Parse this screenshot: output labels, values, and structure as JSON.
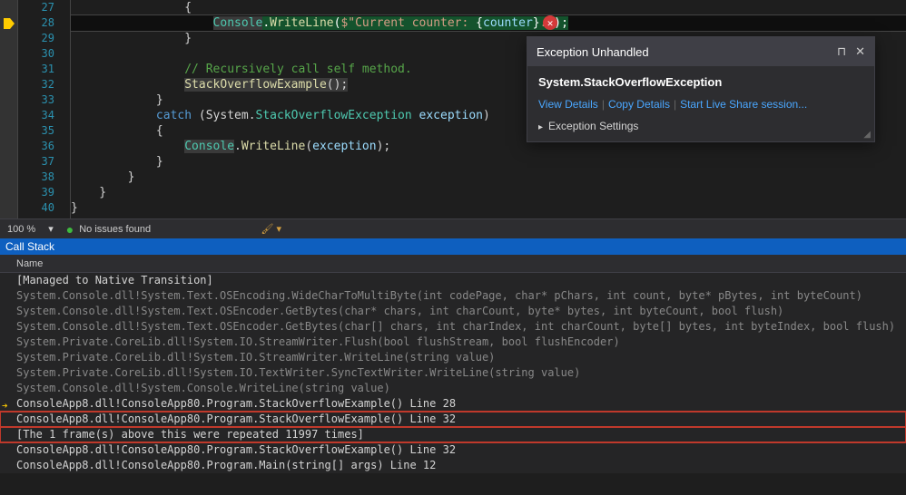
{
  "editor": {
    "lines": [
      27,
      28,
      29,
      30,
      31,
      32,
      33,
      34,
      35,
      36,
      37,
      38,
      39,
      40
    ],
    "comment": "// Recursively call self method.",
    "call_stmt": "StackOverflowExample",
    "catch_kw": "catch",
    "system_ns": "System",
    "exc_type_name": "StackOverflowException",
    "exc_var": "exception",
    "console_type": "Console",
    "writeline_method": "WriteLine",
    "interp_str_open": "$\"Current counter: ",
    "interp_var": "counter",
    "interp_str_close": ".\"",
    "stmt_end": ");",
    "brace_open": "{",
    "brace_close": "}",
    "dot": ".",
    "paren_open": "(",
    "paren_close": ")",
    "semi": ";",
    "space": " "
  },
  "popup": {
    "title": "Exception Unhandled",
    "exc_type": "System.StackOverflowException",
    "view_details": "View Details",
    "copy_details": "Copy Details",
    "live_share": "Start Live Share session...",
    "settings": "Exception Settings",
    "pin_icon": "⊓",
    "close_icon": "✕"
  },
  "status": {
    "zoom": "100 %",
    "issues": "No issues found"
  },
  "callstack": {
    "title": "Call Stack",
    "column": "Name",
    "rows": [
      {
        "text": "[Managed to Native Transition]",
        "bright": true
      },
      {
        "text": "System.Console.dll!System.Text.OSEncoding.WideCharToMultiByte(int codePage, char* pChars, int count, byte* pBytes, int byteCount)"
      },
      {
        "text": "System.Console.dll!System.Text.OSEncoder.GetBytes(char* chars, int charCount, byte* bytes, int byteCount, bool flush)"
      },
      {
        "text": "System.Console.dll!System.Text.OSEncoder.GetBytes(char[] chars, int charIndex, int charCount, byte[] bytes, int byteIndex, bool flush)"
      },
      {
        "text": "System.Private.CoreLib.dll!System.IO.StreamWriter.Flush(bool flushStream, bool flushEncoder)"
      },
      {
        "text": "System.Private.CoreLib.dll!System.IO.StreamWriter.WriteLine(string value)"
      },
      {
        "text": "System.Private.CoreLib.dll!System.IO.TextWriter.SyncTextWriter.WriteLine(string value)"
      },
      {
        "text": "System.Console.dll!System.Console.WriteLine(string value)"
      },
      {
        "text": "ConsoleApp8.dll!ConsoleApp80.Program.StackOverflowExample() Line 28",
        "bright": true,
        "arrow": true
      },
      {
        "text": "ConsoleApp8.dll!ConsoleApp80.Program.StackOverflowExample() Line 32",
        "bright": true,
        "boxed": true
      },
      {
        "text": "[The 1 frame(s) above this were repeated 11997 times]",
        "bright": true,
        "boxed": true
      },
      {
        "text": "ConsoleApp8.dll!ConsoleApp80.Program.StackOverflowExample() Line 32",
        "bright": true
      },
      {
        "text": "ConsoleApp8.dll!ConsoleApp80.Program.Main(string[] args) Line 12",
        "bright": true
      }
    ]
  }
}
